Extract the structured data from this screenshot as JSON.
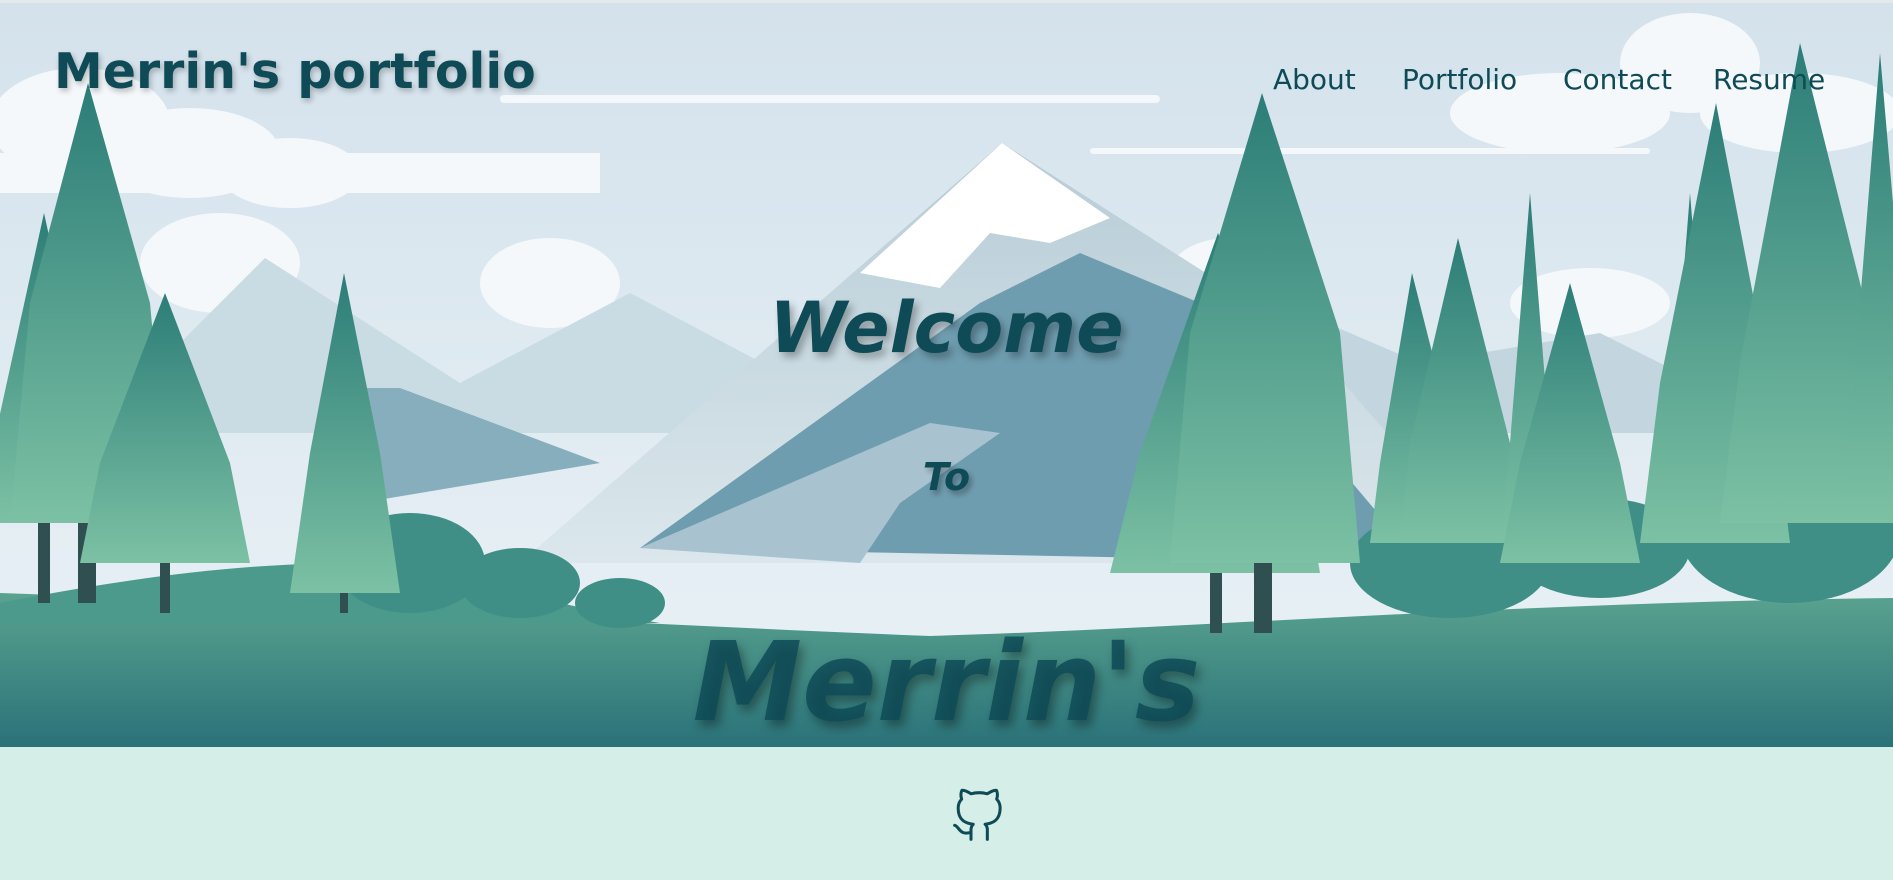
{
  "header": {
    "brand": "Merrin's portfolio",
    "nav": [
      {
        "label": "About"
      },
      {
        "label": "Portfolio"
      },
      {
        "label": "Contact"
      },
      {
        "label": "Resume"
      }
    ]
  },
  "hero": {
    "line1": "Welcome",
    "line2": "To",
    "line3": "Merrin's",
    "background": "mountain-forest-illustration"
  },
  "footer": {
    "icons": [
      {
        "name": "github-icon"
      }
    ]
  },
  "colors": {
    "text": "#0e4b57",
    "footer_bg": "#d5efe8",
    "tree": "#3f8f86",
    "ground": "#3a8a85"
  }
}
